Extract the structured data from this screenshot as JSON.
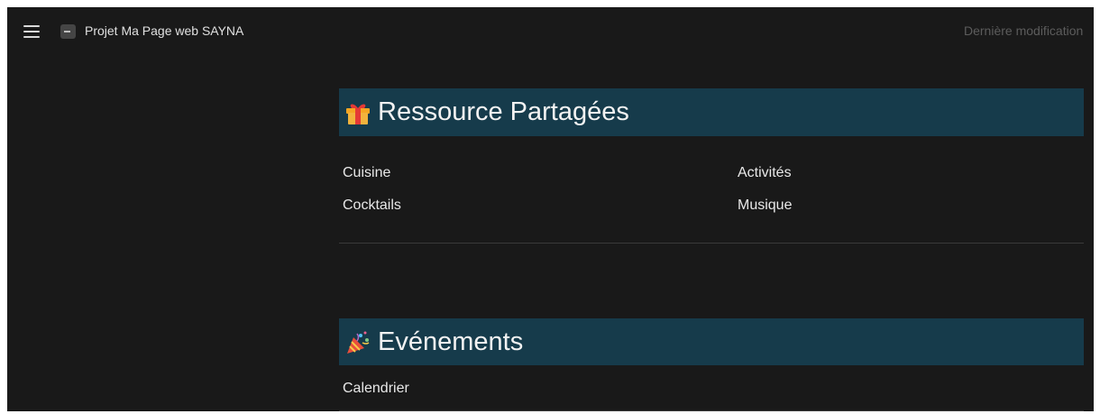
{
  "header": {
    "title": "Projet Ma Page web SAYNA",
    "last_modified": "Dernière modification"
  },
  "icons": {
    "menu": "hamburger-menu-icon",
    "page": "page-icon",
    "gift": "wrapped-gift-emoji",
    "party": "party-popper-emoji"
  },
  "sections": {
    "ressource": {
      "title": "Ressource Partagées",
      "links": [
        "Cuisine",
        "Cocktails",
        "Activités",
        "Musique"
      ]
    },
    "evenements": {
      "title": "Evénements",
      "links": [
        "Calendrier"
      ]
    }
  },
  "colors": {
    "background": "#191919",
    "heading_background": "#163b4b",
    "text": "#e6e6e6"
  }
}
